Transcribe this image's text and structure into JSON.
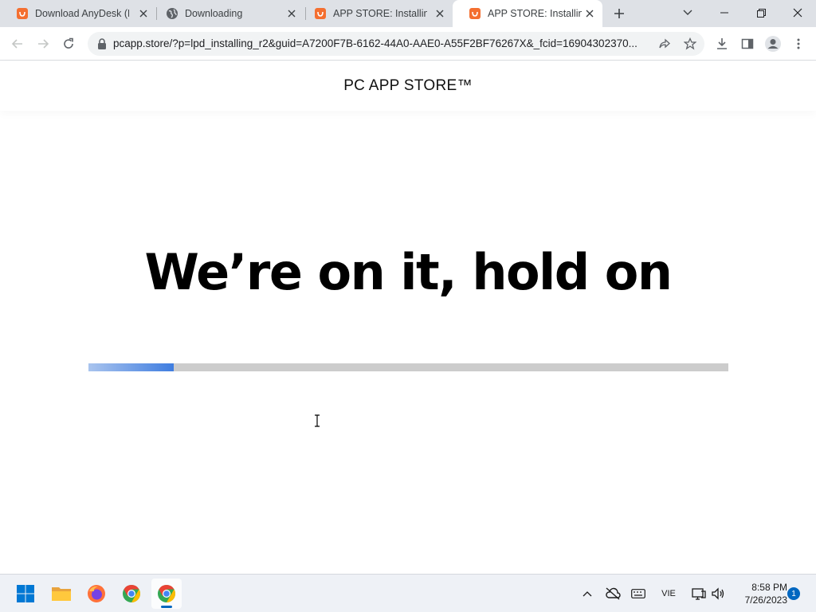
{
  "browser": {
    "tabs": [
      {
        "title": "Download AnyDesk (Pc",
        "favicon": "orange-shopping-bag-icon",
        "active": false
      },
      {
        "title": "Downloading",
        "favicon": "globe-icon",
        "active": false
      },
      {
        "title": "APP STORE: Installing",
        "favicon": "orange-shopping-bag-icon",
        "active": false
      },
      {
        "title": "APP STORE: Installing",
        "favicon": "orange-shopping-bag-icon",
        "active": true
      }
    ],
    "url": "pcapp.store/?p=lpd_installing_r2&guid=A7200F7B-6162-44A0-AAE0-A55F2BF76267X&_fcid=16904302370..."
  },
  "page": {
    "brand": "PC APP STORE™",
    "headline": "We’re on it, hold on",
    "progress": 0.133
  },
  "taskbar": {
    "apps": [
      "start",
      "file-explorer",
      "firefox",
      "chrome",
      "chrome-active"
    ],
    "language": "VIE",
    "time": "8:58 PM",
    "date": "7/26/2023",
    "notification_count": "1"
  },
  "colors": {
    "tab_strip": "#dee1e6",
    "favicon_orange": "#f46f30",
    "progress_fill": "#3f7de0",
    "progress_track": "#cccccc",
    "accent": "#0067c0"
  }
}
